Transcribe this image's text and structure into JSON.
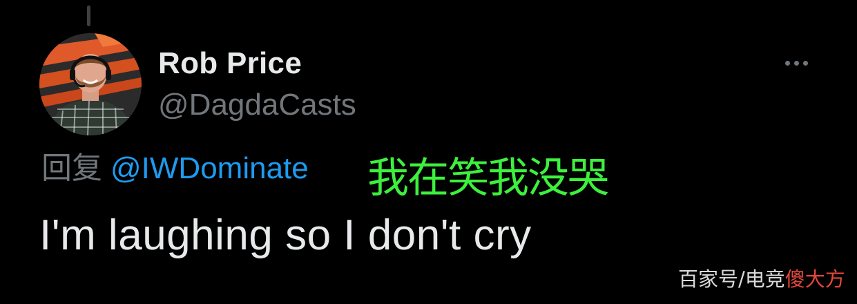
{
  "tweet": {
    "author": {
      "display_name": "Rob Price",
      "handle": "@DagdaCasts",
      "avatar_icon": "profile-photo"
    },
    "reply": {
      "prefix": "回复",
      "mention": "@IWDominate"
    },
    "text": "I'm laughing so I don't cry",
    "more_icon": "ellipsis-icon"
  },
  "overlay": {
    "caption": "我在笑我没哭"
  },
  "watermark": {
    "text_a": "百家号/电竞",
    "text_b": "傻大方"
  },
  "colors": {
    "background": "#000000",
    "primary_text": "#e7e9ea",
    "secondary_text": "#71767b",
    "link": "#1d9bf0",
    "caption_green": "#3df03d",
    "watermark_red": "#e2473b"
  }
}
